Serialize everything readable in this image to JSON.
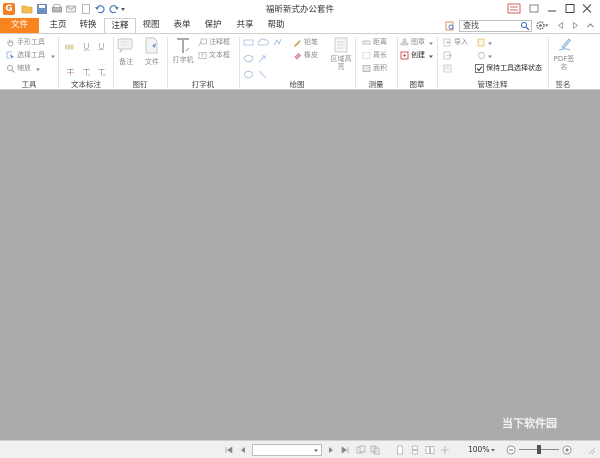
{
  "window": {
    "title": "福昕新式办公套件"
  },
  "tabs": [
    {
      "label": "文件"
    },
    {
      "label": "主页"
    },
    {
      "label": "转换"
    },
    {
      "label": "注释"
    },
    {
      "label": "视图"
    },
    {
      "label": "表单"
    },
    {
      "label": "保护"
    },
    {
      "label": "共享"
    },
    {
      "label": "帮助"
    }
  ],
  "active_tab": "注释",
  "search": {
    "placeholder": "查找"
  },
  "ribbon": {
    "tools": {
      "hand": "手形工具",
      "select": "选择工具",
      "zoom": "缩放",
      "label": "工具"
    },
    "text_markup": {
      "label": "文本标注"
    },
    "pin": {
      "note": "备注",
      "file": "文件",
      "label": "图钉"
    },
    "typewriter": {
      "typewriter": "打字机",
      "callout": "注释框",
      "textbox": "文本框",
      "label": "打字机"
    },
    "drawing": {
      "pencil": "铅笔",
      "eraser": "橡皮",
      "area": "区域高亮",
      "label": "绘图"
    },
    "measure": {
      "distance": "距离",
      "perimeter": "周长",
      "area": "面积",
      "label": "测量"
    },
    "stamp": {
      "stamp": "图章",
      "create": "创建",
      "label": "图章"
    },
    "manage": {
      "import": "导入",
      "keep_tool": "保持工具选择状态",
      "keep_tool_checked": true,
      "label": "管理注释"
    },
    "sign": {
      "pdf_sign": "PDF签名",
      "label": "签名"
    }
  },
  "status": {
    "zoom": "100%"
  },
  "watermark": "当下软件园",
  "colors": {
    "accent": "#f7841f",
    "workspace": "#ababab"
  }
}
